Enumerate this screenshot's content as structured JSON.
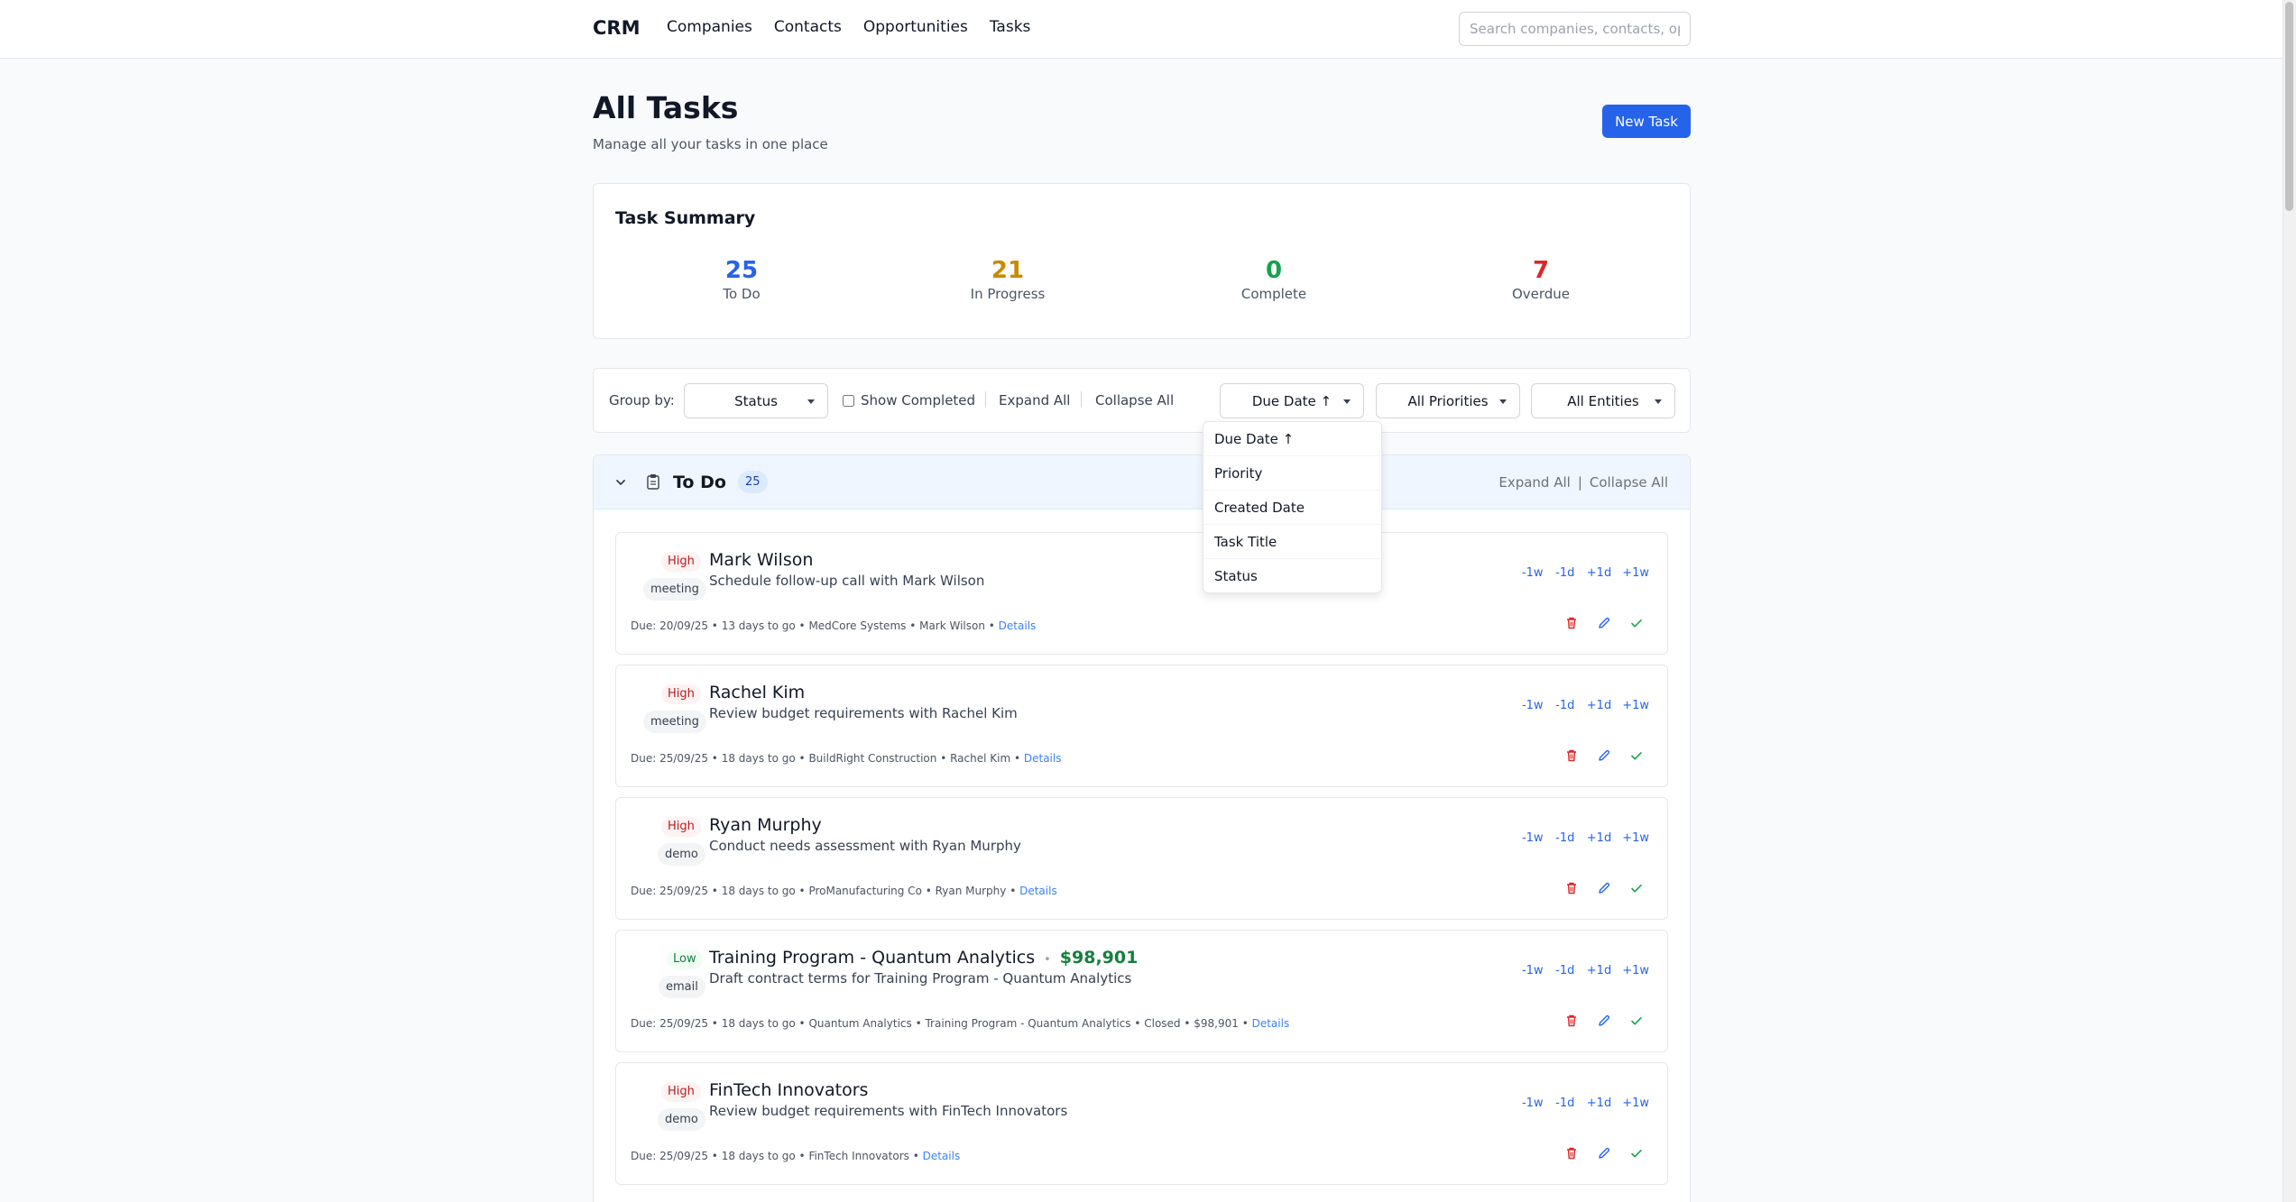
{
  "nav": {
    "brand": "CRM",
    "links": [
      "Companies",
      "Contacts",
      "Opportunities",
      "Tasks"
    ],
    "search_placeholder": "Search companies, contacts, opportunities..."
  },
  "header": {
    "title": "All Tasks",
    "subtitle": "Manage all your tasks in one place",
    "new_task_label": "New Task"
  },
  "summary": {
    "title": "Task Summary",
    "stats": [
      {
        "value": "25",
        "label": "To Do",
        "color": "#2563eb"
      },
      {
        "value": "21",
        "label": "In Progress",
        "color": "#ca8a04"
      },
      {
        "value": "0",
        "label": "Complete",
        "color": "#16a34a"
      },
      {
        "value": "7",
        "label": "Overdue",
        "color": "#dc2626"
      }
    ]
  },
  "filters": {
    "group_by_label": "Group by:",
    "group_by_value": "Status",
    "show_completed_label": "Show Completed",
    "show_completed_checked": false,
    "expand_all": "Expand All",
    "collapse_all": "Collapse All",
    "sort_value": "Due Date ↑",
    "priority_value": "All Priorities",
    "entity_value": "All Entities"
  },
  "sort_menu": {
    "options": [
      "Due Date ↑",
      "Priority",
      "Created Date",
      "Task Title",
      "Status"
    ]
  },
  "group": {
    "title": "To Do",
    "count": "25",
    "expand_all": "Expand All",
    "separator": "|",
    "collapse_all": "Collapse All"
  },
  "shift_buttons": [
    "-1w",
    "-1d",
    "+1d",
    "+1w"
  ],
  "tasks": [
    {
      "priority": "High",
      "type": "meeting",
      "title": "Mark Wilson",
      "amount": "",
      "description": "Schedule follow-up call with Mark Wilson",
      "meta": "Due: 20/09/25 • 13 days to go • MedCore Systems • Mark Wilson • ",
      "details": "Details"
    },
    {
      "priority": "High",
      "type": "meeting",
      "title": "Rachel Kim",
      "amount": "",
      "description": "Review budget requirements with Rachel Kim",
      "meta": "Due: 25/09/25 • 18 days to go • BuildRight Construction • Rachel Kim • ",
      "details": "Details"
    },
    {
      "priority": "High",
      "type": "demo",
      "title": "Ryan Murphy",
      "amount": "",
      "description": "Conduct needs assessment with Ryan Murphy",
      "meta": "Due: 25/09/25 • 18 days to go • ProManufacturing Co • Ryan Murphy • ",
      "details": "Details"
    },
    {
      "priority": "Low",
      "type": "email",
      "title": "Training Program - Quantum Analytics",
      "amount": "$98,901",
      "description": "Draft contract terms for Training Program - Quantum Analytics",
      "meta": "Due: 25/09/25 • 18 days to go • Quantum Analytics • Training Program - Quantum Analytics • Closed • $98,901 • ",
      "details": "Details"
    },
    {
      "priority": "High",
      "type": "demo",
      "title": "FinTech Innovators",
      "amount": "",
      "description": "Review budget requirements with FinTech Innovators",
      "meta": "Due: 25/09/25 • 18 days to go • FinTech Innovators • ",
      "details": "Details"
    }
  ],
  "icons": {
    "delete": "trash-icon",
    "edit": "pencil-icon",
    "complete": "check-icon",
    "group_toggle": "chevron-down-icon",
    "group_icon": "clipboard-icon"
  }
}
